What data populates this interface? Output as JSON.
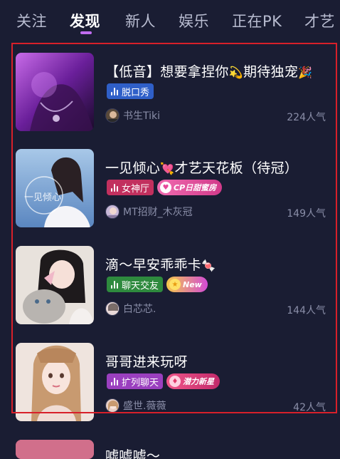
{
  "tabs": [
    {
      "label": "关注",
      "active": false
    },
    {
      "label": "发现",
      "active": true
    },
    {
      "label": "新人",
      "active": false
    },
    {
      "label": "娱乐",
      "active": false
    },
    {
      "label": "正在PK",
      "active": false
    },
    {
      "label": "才艺",
      "active": false
    }
  ],
  "rooms": [
    {
      "title": "【低音】想要拿捏你",
      "title_emoji_1": "💫",
      "title_tail": "期待独宠",
      "title_emoji_2": "🎉",
      "category": "脱口秀",
      "category_color": "#2f5fc8",
      "badge": "",
      "host": "书生Tiki",
      "popularity": "224人气"
    },
    {
      "title": "一见倾心",
      "title_emoji_1": "💘",
      "title_tail": "才艺天花板（待冠）",
      "title_emoji_2": "",
      "category": "女神厅",
      "category_color": "#c2305e",
      "badge": "CP日甜蜜房",
      "badge_color": "#e64a9a",
      "host": "MT招财_木灰冠",
      "popularity": "149人气",
      "thumb_text": "一见倾心"
    },
    {
      "title": "滴～早安乖乖卡",
      "title_emoji_1": "🍬",
      "title_tail": "",
      "title_emoji_2": "",
      "category": "聊天交友",
      "category_color": "#2e8a3e",
      "badge": "New",
      "badge_color": "#d24bd6",
      "host": "白芯芯.",
      "popularity": "144人气"
    },
    {
      "title": "哥哥进来玩呀",
      "title_emoji_1": "",
      "title_tail": "",
      "title_emoji_2": "",
      "category": "扩列聊天",
      "category_color": "#9a3fbf",
      "badge": "潜力新星",
      "badge_color": "#e23a6a",
      "host": "盛世.薇薇",
      "popularity": "42人气"
    }
  ],
  "partial_room": {
    "title": "嘘嘘嘘～"
  },
  "colors": {
    "background": "#1a1d33",
    "accent": "#c06cf0",
    "highlight": "#d8202a"
  }
}
